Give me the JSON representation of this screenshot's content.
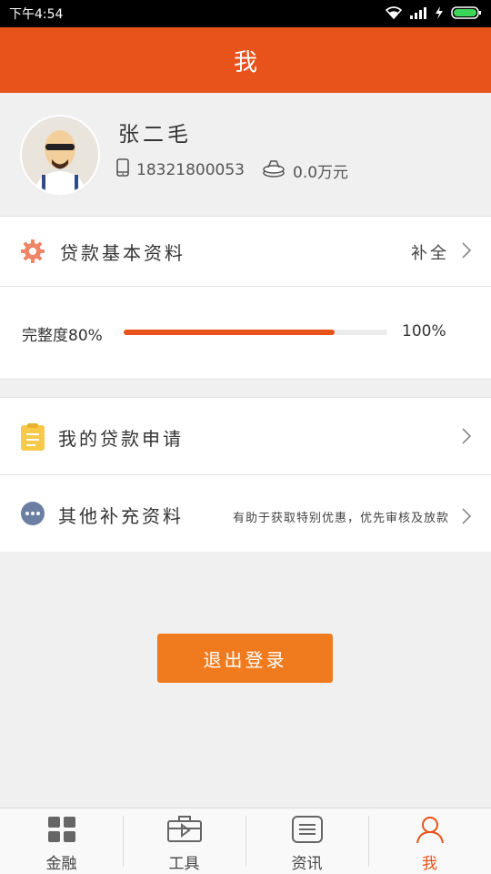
{
  "status_bar": {
    "time": "下午4:54"
  },
  "header": {
    "title": "我"
  },
  "profile": {
    "name": "张二毛",
    "phone": "18321800053",
    "balance": "0.0万元"
  },
  "loan_basic": {
    "label": "贷款基本资料",
    "action": "补全"
  },
  "completeness": {
    "label": "完整度80%",
    "max_label": "100%",
    "value": 0.8
  },
  "menu": {
    "my_loan": {
      "label": "我的贷款申请"
    },
    "other": {
      "label": "其他补充资料",
      "hint": "有助于获取特别优惠，优先审核及放款"
    }
  },
  "logout": {
    "label": "退出登录"
  },
  "tabs": [
    {
      "label": "金融",
      "icon": "grid-icon"
    },
    {
      "label": "工具",
      "icon": "toolbox-icon"
    },
    {
      "label": "资讯",
      "icon": "news-icon"
    },
    {
      "label": "我",
      "icon": "person-icon"
    }
  ],
  "colors": {
    "accent": "#e8521b",
    "button": "#f07b1e",
    "yellow_icon": "#f7c948",
    "gray_icon": "#6b7fa3"
  }
}
